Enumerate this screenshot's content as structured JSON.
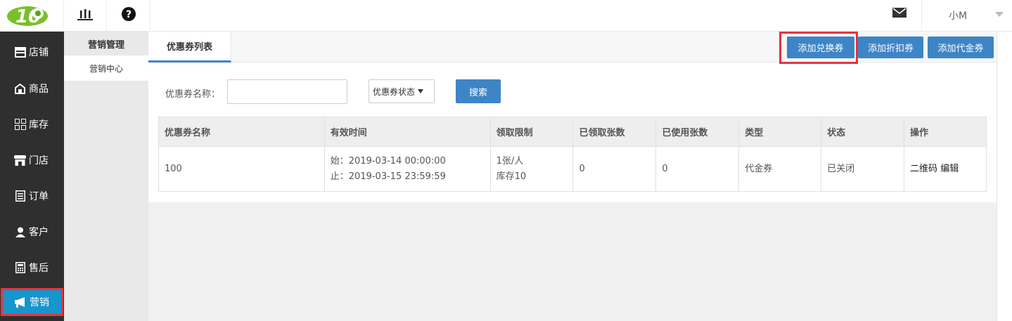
{
  "topbar": {
    "logo_icon": "logo-10-icon",
    "stats_icon": "bar-chart-icon",
    "help_icon": "question-circle-icon",
    "mail_icon": "envelope-icon",
    "user_name": "小M"
  },
  "leftnav": {
    "items": [
      {
        "label": "店铺",
        "icon": "store-icon"
      },
      {
        "label": "商品",
        "icon": "goods-icon"
      },
      {
        "label": "库存",
        "icon": "grid-icon"
      },
      {
        "label": "门店",
        "icon": "shop-icon"
      },
      {
        "label": "订单",
        "icon": "order-icon"
      },
      {
        "label": "客户",
        "icon": "user-icon"
      },
      {
        "label": "售后",
        "icon": "calculator-icon"
      },
      {
        "label": "营销",
        "icon": "megaphone-icon"
      }
    ]
  },
  "subnav": {
    "title": "营销管理",
    "item": "营销中心"
  },
  "content": {
    "tab": "优惠券列表",
    "buttons": {
      "exchange": "添加兑换券",
      "discount": "添加折扣券",
      "cash": "添加代金券"
    },
    "filter": {
      "name_label": "优惠券名称：",
      "name_value": "",
      "status_select": "优惠券状态",
      "search": "搜索"
    },
    "table": {
      "headers": [
        "优惠券名称",
        "有效时间",
        "领取限制",
        "已领取张数",
        "已使用张数",
        "类型",
        "状态",
        "操作"
      ],
      "rows": [
        {
          "name": "100",
          "start": "始：2019-03-14 00:00:00",
          "end": "止：2019-03-15 23:59:59",
          "limit1": "1张/人",
          "limit2": "库存10",
          "received": "0",
          "used": "0",
          "type": "代金券",
          "status": "已关闭",
          "action_qr": "二维码",
          "action_edit": "编辑"
        }
      ]
    }
  },
  "colors": {
    "primary": "#3d85c6",
    "nav_bg": "#2f2f2f",
    "nav_active": "#1795cd",
    "highlight": "#e8323c"
  }
}
